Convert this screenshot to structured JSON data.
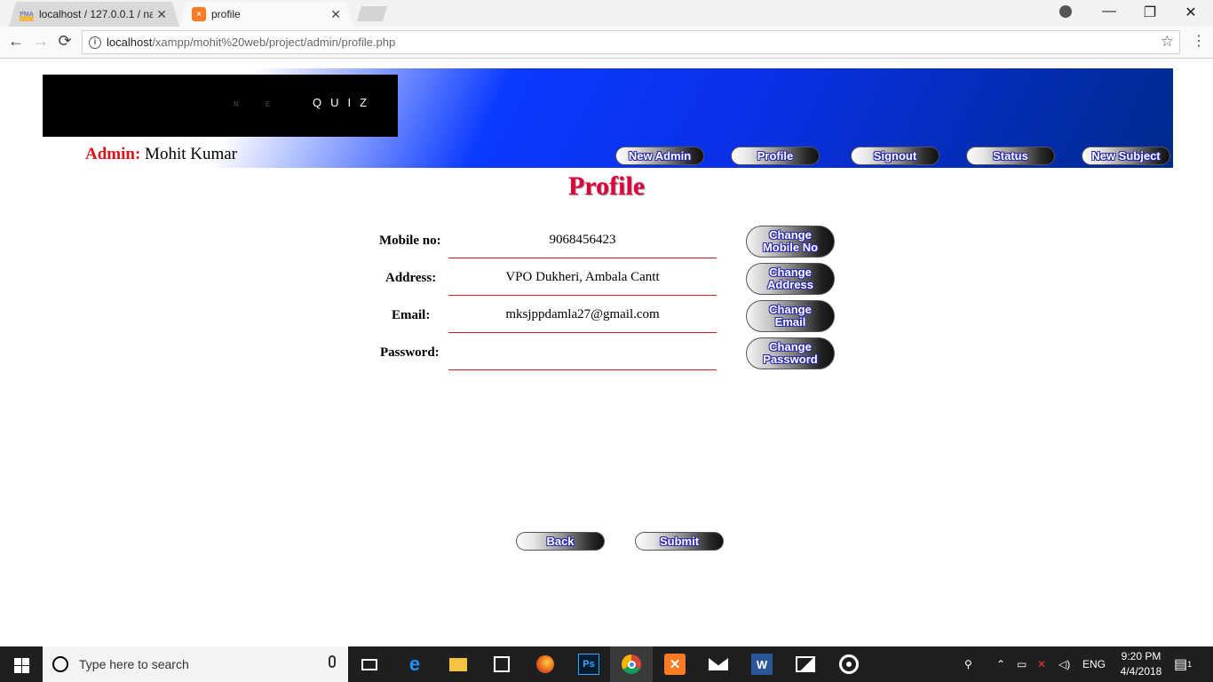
{
  "browser": {
    "tabs": [
      {
        "title": "localhost / 127.0.0.1 / na",
        "favicon": "phpmyadmin-icon",
        "close": "✕"
      },
      {
        "title": "profile",
        "favicon": "xampp-icon",
        "close": "✕"
      }
    ],
    "url_host": "localhost",
    "url_path": "/xampp/mohit%20web/project/admin/profile.php",
    "back_glyph": "←",
    "forward_glyph": "→",
    "reload_glyph": "⟳",
    "star_glyph": "☆",
    "menu_glyph": "⋮",
    "minimize_glyph": "—",
    "restore_glyph": "❐",
    "close_glyph": "✕"
  },
  "header": {
    "logo_faint": "N E",
    "logo_text": "QUIZ",
    "admin_label": "Admin:",
    "admin_name": "Mohit Kumar",
    "nav": [
      {
        "label": "New Admin"
      },
      {
        "label": "Profile"
      },
      {
        "label": "Signout"
      },
      {
        "label": "Status"
      },
      {
        "label": "New Subject"
      }
    ]
  },
  "page": {
    "title": "Profile",
    "fields": [
      {
        "label": "Mobile no:",
        "value": "9068456423",
        "button": [
          "Change",
          "Mobile No"
        ]
      },
      {
        "label": "Address:",
        "value": "VPO Dukheri, Ambala Cantt",
        "button": [
          "Change",
          "Address"
        ]
      },
      {
        "label": "Email:",
        "value": "mksjppdamla27@gmail.com",
        "button": [
          "Change",
          "Email"
        ]
      },
      {
        "label": "Password:",
        "value": "",
        "button": [
          "Change",
          "Password"
        ]
      }
    ],
    "back_label": "Back",
    "submit_label": "Submit"
  },
  "taskbar": {
    "search_placeholder": "Type here to search",
    "language": "ENG",
    "time": "9:20 PM",
    "date": "4/4/2018",
    "notification_count": "1",
    "apps": [
      "task-view-icon",
      "edge-icon",
      "file-explorer-icon",
      "store-icon",
      "firefox-icon",
      "photoshop-icon",
      "chrome-icon",
      "xampp-icon",
      "mail-icon",
      "word-icon",
      "photos-icon",
      "groove-icon"
    ]
  }
}
